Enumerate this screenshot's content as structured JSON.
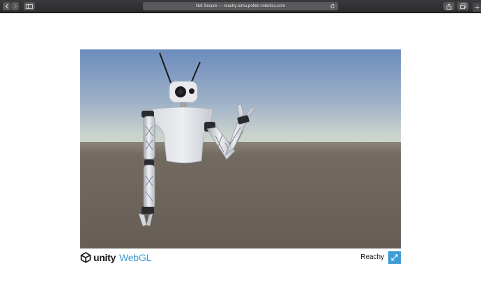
{
  "browser": {
    "address_text": "Not Secure — reachy-simu.pollen-robotics.com",
    "icons": {
      "back": "chevron-left-icon",
      "forward": "chevron-right-icon",
      "sidebar": "sidebar-icon",
      "reload": "reload-icon",
      "share": "share-icon",
      "tabs": "tabs-icon",
      "new_tab": "plus-icon"
    }
  },
  "webgl_player": {
    "scene": "Reachy robot render on sky and ground backdrop",
    "footer": {
      "logo_text": "unity",
      "webgl_text": "WebGL",
      "title": "Reachy",
      "fullscreen_icon": "fullscreen-icon"
    }
  },
  "colors": {
    "sky_top": "#6f8fbe",
    "sky_horizon": "#c8d2cf",
    "ground": "#6b625a",
    "webgl_blue": "#3d9bd5",
    "toolbar": "#333335"
  }
}
